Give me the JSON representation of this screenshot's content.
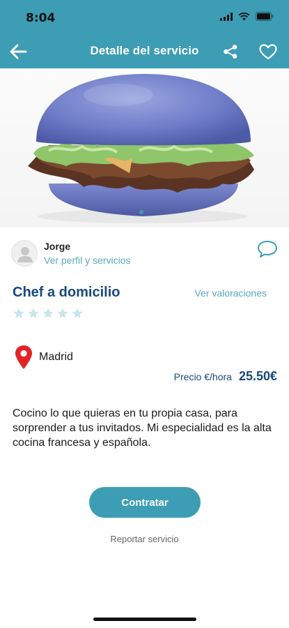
{
  "status_bar": {
    "time": "8:04"
  },
  "header": {
    "title": "Detalle del servicio"
  },
  "author": {
    "name": "Jorge",
    "profile_link": "Ver perfil y servicios"
  },
  "service": {
    "title": "Chef a domicilio",
    "ratings_link": "Ver valoraciones",
    "stars": 5,
    "location": "Madrid",
    "price_label": "Precio €/hora",
    "price_value": "25.50€",
    "description": "Cocino lo que quieras en tu propia casa, para sorprender a tus invitados. Mi especialidad es la alta cocina francesa y española."
  },
  "actions": {
    "contract_label": "Contratar",
    "report_label": "Reportar servicio"
  },
  "colors": {
    "primary": "#3c9db4",
    "title_blue": "#17497e",
    "link": "#5aa9bd",
    "star": "#cbe3ea",
    "pin": "#e32227"
  },
  "icons": [
    "back-arrow-icon",
    "share-icon",
    "heart-icon",
    "avatar-icon",
    "chat-bubble-icon",
    "star-icon",
    "location-pin-icon",
    "wifi-icon",
    "battery-icon",
    "signal-icon"
  ]
}
